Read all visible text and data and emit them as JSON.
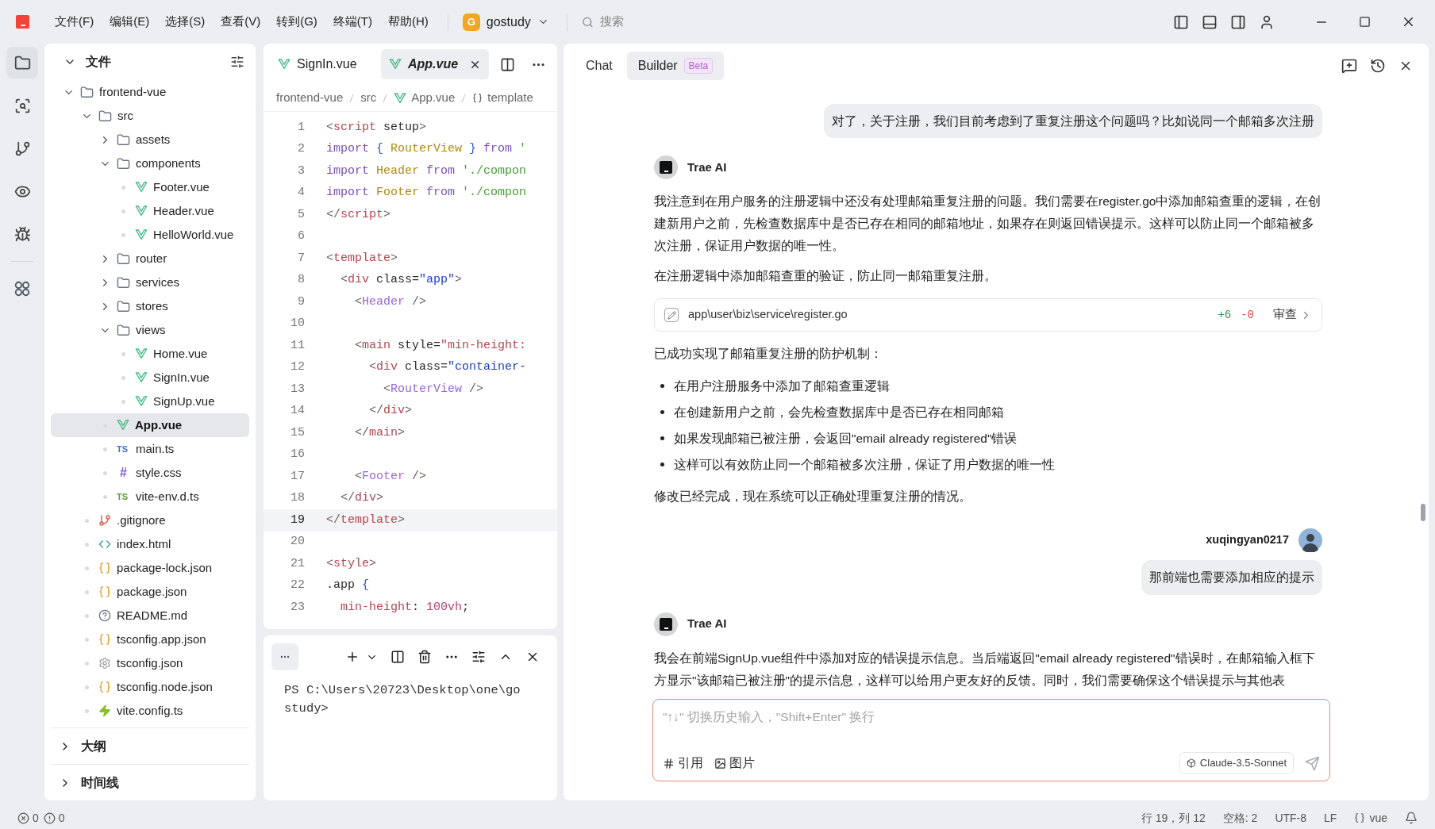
{
  "menu": [
    "文件(F)",
    "编辑(E)",
    "选择(S)",
    "查看(V)",
    "转到(G)",
    "终端(T)",
    "帮助(H)"
  ],
  "project": {
    "badge": "G",
    "name": "gostudy"
  },
  "search": {
    "placeholder": "搜索"
  },
  "activity_bar": [
    {
      "kind": "files",
      "selected": true
    },
    {
      "kind": "search",
      "selected": false
    },
    {
      "kind": "git",
      "selected": false
    },
    {
      "kind": "preview",
      "selected": false
    },
    {
      "kind": "debug",
      "selected": false
    },
    {
      "kind": "extensions",
      "selected": false
    }
  ],
  "explorer": {
    "title": "文件",
    "tree": [
      {
        "name": "frontend-vue",
        "kind": "folder",
        "expanded": true,
        "selected": false,
        "children": [
          {
            "name": "src",
            "kind": "folder",
            "expanded": true,
            "selected": false,
            "children": [
              {
                "name": "assets",
                "kind": "folder",
                "expanded": false,
                "selected": false
              },
              {
                "name": "components",
                "kind": "folder",
                "expanded": true,
                "selected": false,
                "children": [
                  {
                    "name": "Footer.vue",
                    "kind": "vue",
                    "selected": false
                  },
                  {
                    "name": "Header.vue",
                    "kind": "vue",
                    "selected": false
                  },
                  {
                    "name": "HelloWorld.vue",
                    "kind": "vue",
                    "selected": false
                  }
                ]
              },
              {
                "name": "router",
                "kind": "folder",
                "expanded": false,
                "selected": false
              },
              {
                "name": "services",
                "kind": "folder",
                "expanded": false,
                "selected": false
              },
              {
                "name": "stores",
                "kind": "folder",
                "expanded": false,
                "selected": false
              },
              {
                "name": "views",
                "kind": "folder",
                "expanded": true,
                "selected": false,
                "children": [
                  {
                    "name": "Home.vue",
                    "kind": "vue",
                    "selected": false
                  },
                  {
                    "name": "SignIn.vue",
                    "kind": "vue",
                    "selected": false
                  },
                  {
                    "name": "SignUp.vue",
                    "kind": "vue",
                    "selected": false
                  }
                ]
              },
              {
                "name": "App.vue",
                "kind": "vue",
                "selected": true
              },
              {
                "name": "main.ts",
                "kind": "ts",
                "icon_text": "TS",
                "selected": false
              },
              {
                "name": "style.css",
                "kind": "css",
                "icon_text": "#",
                "selected": false
              },
              {
                "name": "vite-env.d.ts",
                "kind": "dts",
                "icon_text": "TS",
                "selected": false
              }
            ]
          },
          {
            "name": ".gitignore",
            "kind": "git",
            "selected": false
          },
          {
            "name": "index.html",
            "kind": "html",
            "selected": false
          },
          {
            "name": "package-lock.json",
            "kind": "json",
            "selected": false
          },
          {
            "name": "package.json",
            "kind": "json",
            "selected": false
          },
          {
            "name": "README.md",
            "kind": "md",
            "selected": false
          },
          {
            "name": "tsconfig.app.json",
            "kind": "json",
            "selected": false
          },
          {
            "name": "tsconfig.json",
            "kind": "config",
            "selected": false
          },
          {
            "name": "tsconfig.node.json",
            "kind": "json",
            "selected": false
          },
          {
            "name": "vite.config.ts",
            "kind": "vite",
            "selected": false
          }
        ]
      }
    ],
    "sections": [
      {
        "title": "大纲",
        "expanded": false
      },
      {
        "title": "时间线",
        "expanded": false
      }
    ]
  },
  "editor": {
    "tabs": [
      {
        "label": "SignIn.vue",
        "selected": false
      },
      {
        "label": "App.vue",
        "selected": true
      }
    ],
    "breadcrumb": [
      {
        "text": "frontend-vue",
        "kind": "plain"
      },
      {
        "text": "src",
        "kind": "plain"
      },
      {
        "text": "App.vue",
        "kind": "vue"
      },
      {
        "text": "template",
        "kind": "braces"
      }
    ],
    "lines": [
      {
        "n": "1",
        "current": false,
        "tokens": [
          {
            "text": "<",
            "kind": "p"
          },
          {
            "text": "script",
            "kind": "tag"
          },
          {
            "text": " setup",
            "kind": "at"
          },
          {
            "text": ">",
            "kind": "p"
          }
        ]
      },
      {
        "n": "2",
        "current": false,
        "tokens": [
          {
            "text": "import",
            "kind": "kw"
          },
          {
            "text": " { ",
            "kind": "br"
          },
          {
            "text": "RouterView",
            "kind": "cls"
          },
          {
            "text": " } ",
            "kind": "br"
          },
          {
            "text": "from",
            "kind": "kw"
          },
          {
            "text": " '",
            "kind": "str"
          }
        ]
      },
      {
        "n": "3",
        "current": false,
        "tokens": [
          {
            "text": "import",
            "kind": "kw"
          },
          {
            "text": " Header ",
            "kind": "cls"
          },
          {
            "text": "from",
            "kind": "kw"
          },
          {
            "text": " './compon",
            "kind": "str"
          }
        ]
      },
      {
        "n": "4",
        "current": false,
        "tokens": [
          {
            "text": "import",
            "kind": "kw"
          },
          {
            "text": " Footer ",
            "kind": "cls"
          },
          {
            "text": "from",
            "kind": "kw"
          },
          {
            "text": " './compon",
            "kind": "str"
          }
        ]
      },
      {
        "n": "5",
        "current": false,
        "tokens": [
          {
            "text": "</",
            "kind": "p"
          },
          {
            "text": "script",
            "kind": "tag"
          },
          {
            "text": ">",
            "kind": "p"
          }
        ]
      },
      {
        "n": "6",
        "current": false
      },
      {
        "n": "7",
        "current": false,
        "tokens": [
          {
            "text": "<",
            "kind": "p"
          },
          {
            "text": "template",
            "kind": "tag"
          },
          {
            "text": ">",
            "kind": "p"
          }
        ]
      },
      {
        "n": "8",
        "current": false,
        "tokens": [
          {
            "text": "  <",
            "kind": "p"
          },
          {
            "text": "div",
            "kind": "tag"
          },
          {
            "text": " class=",
            "kind": "at"
          },
          {
            "text": "\"app\"",
            "kind": "val"
          },
          {
            "text": ">",
            "kind": "p"
          }
        ]
      },
      {
        "n": "9",
        "current": false,
        "tokens": [
          {
            "text": "    <",
            "kind": "p"
          },
          {
            "text": "Header",
            "kind": "comp"
          },
          {
            "text": " />",
            "kind": "p"
          }
        ]
      },
      {
        "n": "10",
        "current": false
      },
      {
        "n": "11",
        "current": false,
        "tokens": [
          {
            "text": "    <",
            "kind": "p"
          },
          {
            "text": "main",
            "kind": "tag"
          },
          {
            "text": " style=",
            "kind": "at"
          },
          {
            "text": "\"min-height:",
            "kind": "tag"
          }
        ]
      },
      {
        "n": "12",
        "current": false,
        "tokens": [
          {
            "text": "      <",
            "kind": "p"
          },
          {
            "text": "div",
            "kind": "tag"
          },
          {
            "text": " class=",
            "kind": "at"
          },
          {
            "text": "\"container-",
            "kind": "val"
          }
        ]
      },
      {
        "n": "13",
        "current": false,
        "tokens": [
          {
            "text": "        <",
            "kind": "p"
          },
          {
            "text": "RouterView",
            "kind": "comp"
          },
          {
            "text": " />",
            "kind": "p"
          }
        ]
      },
      {
        "n": "14",
        "current": false,
        "tokens": [
          {
            "text": "      </",
            "kind": "p"
          },
          {
            "text": "div",
            "kind": "tag"
          },
          {
            "text": ">",
            "kind": "p"
          }
        ]
      },
      {
        "n": "15",
        "current": false,
        "tokens": [
          {
            "text": "    </",
            "kind": "p"
          },
          {
            "text": "main",
            "kind": "tag"
          },
          {
            "text": ">",
            "kind": "p"
          }
        ]
      },
      {
        "n": "16",
        "current": false
      },
      {
        "n": "17",
        "current": false,
        "tokens": [
          {
            "text": "    <",
            "kind": "p"
          },
          {
            "text": "Footer",
            "kind": "comp"
          },
          {
            "text": " />",
            "kind": "p"
          }
        ]
      },
      {
        "n": "18",
        "current": false,
        "tokens": [
          {
            "text": "  </",
            "kind": "p"
          },
          {
            "text": "div",
            "kind": "tag"
          },
          {
            "text": ">",
            "kind": "p"
          }
        ]
      },
      {
        "n": "19",
        "current": true,
        "tokens": [
          {
            "text": "</",
            "kind": "p"
          },
          {
            "text": "template",
            "kind": "tag"
          },
          {
            "text": ">",
            "kind": "p"
          }
        ]
      },
      {
        "n": "20",
        "current": false
      },
      {
        "n": "21",
        "current": false,
        "tokens": [
          {
            "text": "<",
            "kind": "p"
          },
          {
            "text": "style",
            "kind": "tag"
          },
          {
            "text": ">",
            "kind": "p"
          }
        ]
      },
      {
        "n": "22",
        "current": false,
        "tokens": [
          {
            "text": ".app ",
            "kind": "at"
          },
          {
            "text": "{",
            "kind": "br"
          }
        ]
      },
      {
        "n": "23",
        "current": false,
        "tokens": [
          {
            "text": "  min-height",
            "kind": "tag"
          },
          {
            "text": ": ",
            "kind": "at"
          },
          {
            "text": "100vh",
            "kind": "num"
          },
          {
            "text": ";",
            "kind": "at"
          }
        ]
      }
    ]
  },
  "terminal": {
    "lines": [
      "PS C:\\Users\\20723\\Desktop\\one\\go",
      "study>"
    ]
  },
  "chat": {
    "tabs": [
      {
        "label": "Chat",
        "selected": false
      },
      {
        "label": "Builder",
        "badge": "Beta",
        "selected": true
      }
    ],
    "messages": [
      {
        "kind": "user",
        "text": "对了，关于注册，我们目前考虑到了重复注册这个问题吗？比如说同一个邮箱多次注册"
      },
      {
        "kind": "ai",
        "author": "Trae AI",
        "blocks": [
          {
            "kind": "p",
            "text": "我注意到在用户服务的注册逻辑中还没有处理邮箱重复注册的问题。我们需要在register.go中添加邮箱查重的逻辑，在创建新用户之前，先检查数据库中是否已存在相同的邮箱地址，如果存在则返回错误提示。这样可以防止同一个邮箱被多次注册，保证用户数据的唯一性。"
          },
          {
            "kind": "p",
            "text": "在注册逻辑中添加邮箱查重的验证，防止同一邮箱重复注册。"
          },
          {
            "kind": "file",
            "path": "app\\user\\biz\\service\\register.go",
            "added": "+6",
            "removed": "-0",
            "action": "审查"
          },
          {
            "kind": "p",
            "text": "已成功实现了邮箱重复注册的防护机制："
          },
          {
            "kind": "list",
            "items": [
              "在用户注册服务中添加了邮箱查重逻辑",
              "在创建新用户之前，会先检查数据库中是否已存在相同邮箱",
              "如果发现邮箱已被注册，会返回\"email already registered\"错误",
              "这样可以有效防止同一个邮箱被多次注册，保证了用户数据的唯一性"
            ]
          },
          {
            "kind": "p",
            "text": "修改已经完成，现在系统可以正确处理重复注册的情况。"
          }
        ]
      },
      {
        "kind": "user",
        "author": "xuqingyan0217",
        "text": "那前端也需要添加相应的提示"
      },
      {
        "kind": "ai",
        "author": "Trae AI",
        "blocks": [
          {
            "kind": "p",
            "text": "我会在前端SignUp.vue组件中添加对应的错误提示信息。当后端返回\"email already registered\"错误时，在邮箱输入框下方显示\"该邮箱已被注册\"的提示信息，这样可以给用户更友好的反馈。同时，我们需要确保这个错误提示与其他表"
          }
        ]
      }
    ],
    "input": {
      "placeholder": "\"↑↓\" 切换历史输入，\"Shift+Enter\" 换行",
      "actions": [
        {
          "kind": "hash",
          "label": "引用"
        },
        {
          "kind": "image",
          "label": "图片"
        }
      ],
      "model": "Claude-3.5-Sonnet"
    }
  },
  "status_bar": {
    "errors": "0",
    "warnings": "0",
    "items": [
      "行 19，列 12",
      "空格: 2",
      "UTF-8",
      "LF"
    ],
    "language": "vue"
  }
}
